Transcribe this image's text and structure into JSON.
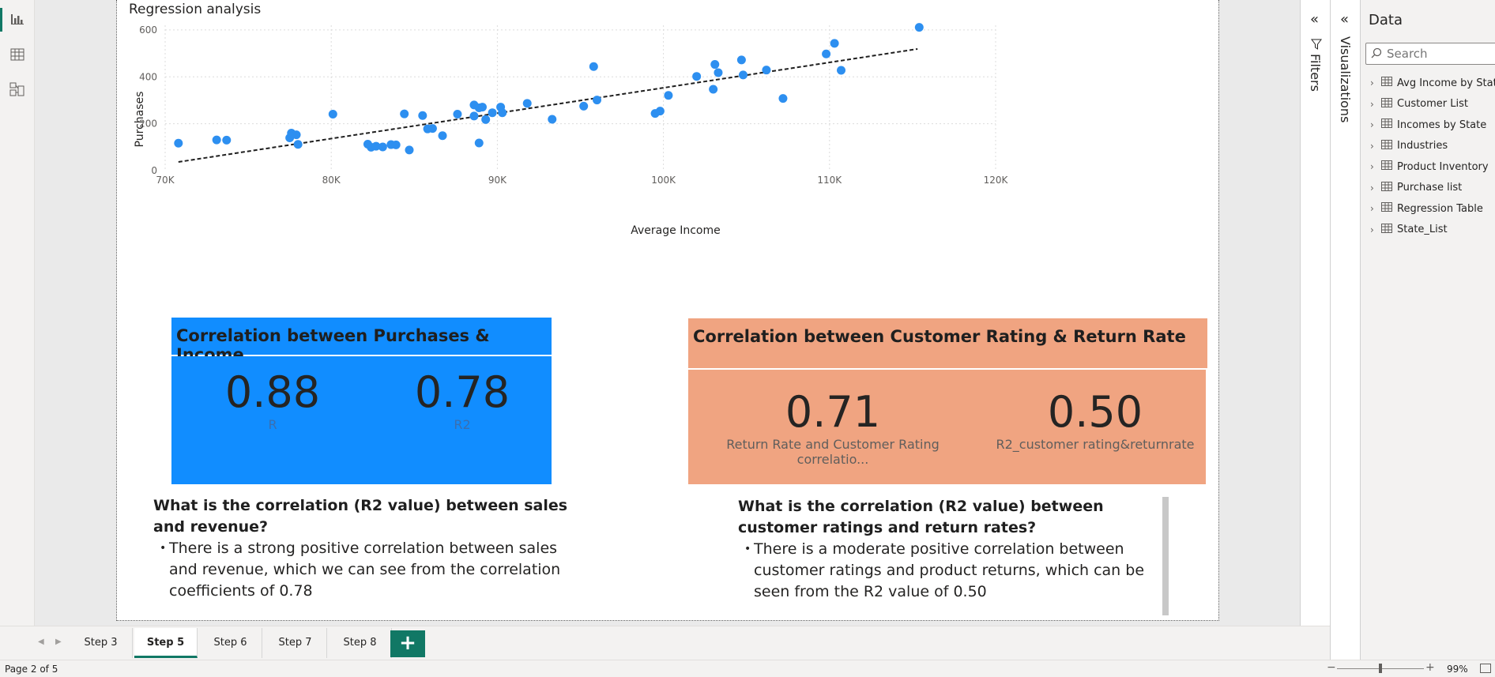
{
  "left_rail": {
    "icons": [
      "report-view-icon",
      "table-view-icon",
      "model-view-icon"
    ]
  },
  "scatter": {
    "title": "Regression analysis",
    "ylabel": "Purchases",
    "xlabel": "Average Income",
    "point_color": "#2d8ff0"
  },
  "chart_data": {
    "type": "scatter",
    "title": "Regression analysis",
    "xlabel": "Average Income",
    "ylabel": "Purchases",
    "xlim": [
      70000,
      120000
    ],
    "ylim": [
      0,
      620
    ],
    "x_ticks": [
      70000,
      80000,
      90000,
      100000,
      110000,
      120000
    ],
    "x_tick_labels": [
      "70K",
      "80K",
      "90K",
      "100K",
      "110K",
      "120K"
    ],
    "y_ticks": [
      0,
      200,
      400,
      600
    ],
    "y_tick_labels": [
      "0",
      "200",
      "400",
      "600"
    ],
    "grid": true,
    "trend_line": {
      "x": [
        70800,
        115300
      ],
      "y": [
        37,
        519
      ],
      "style": "dashed"
    },
    "points": [
      {
        "x": 70800,
        "y": 117
      },
      {
        "x": 73100,
        "y": 131
      },
      {
        "x": 73700,
        "y": 130
      },
      {
        "x": 77500,
        "y": 140
      },
      {
        "x": 77600,
        "y": 160
      },
      {
        "x": 77900,
        "y": 153
      },
      {
        "x": 78000,
        "y": 112
      },
      {
        "x": 80100,
        "y": 241
      },
      {
        "x": 82200,
        "y": 113
      },
      {
        "x": 82400,
        "y": 100
      },
      {
        "x": 82700,
        "y": 104
      },
      {
        "x": 83100,
        "y": 101
      },
      {
        "x": 83600,
        "y": 111
      },
      {
        "x": 83900,
        "y": 110
      },
      {
        "x": 84400,
        "y": 242
      },
      {
        "x": 84700,
        "y": 88
      },
      {
        "x": 85500,
        "y": 235
      },
      {
        "x": 85800,
        "y": 178
      },
      {
        "x": 86100,
        "y": 180
      },
      {
        "x": 86700,
        "y": 149
      },
      {
        "x": 87600,
        "y": 241
      },
      {
        "x": 88600,
        "y": 280
      },
      {
        "x": 88600,
        "y": 233
      },
      {
        "x": 88900,
        "y": 268
      },
      {
        "x": 88900,
        "y": 118
      },
      {
        "x": 89100,
        "y": 271
      },
      {
        "x": 89300,
        "y": 218
      },
      {
        "x": 89700,
        "y": 247
      },
      {
        "x": 90200,
        "y": 271
      },
      {
        "x": 90300,
        "y": 247
      },
      {
        "x": 91800,
        "y": 287
      },
      {
        "x": 93300,
        "y": 219
      },
      {
        "x": 95200,
        "y": 275
      },
      {
        "x": 95800,
        "y": 444
      },
      {
        "x": 96000,
        "y": 301
      },
      {
        "x": 99500,
        "y": 244
      },
      {
        "x": 99800,
        "y": 254
      },
      {
        "x": 100300,
        "y": 321
      },
      {
        "x": 102000,
        "y": 402
      },
      {
        "x": 103000,
        "y": 347
      },
      {
        "x": 103100,
        "y": 453
      },
      {
        "x": 103300,
        "y": 418
      },
      {
        "x": 104700,
        "y": 472
      },
      {
        "x": 104800,
        "y": 408
      },
      {
        "x": 106200,
        "y": 429
      },
      {
        "x": 107200,
        "y": 308
      },
      {
        "x": 109800,
        "y": 498
      },
      {
        "x": 110300,
        "y": 543
      },
      {
        "x": 110700,
        "y": 428
      },
      {
        "x": 115400,
        "y": 611
      }
    ]
  },
  "card_left": {
    "title": "Correlation between Purchases & Income",
    "kpis": [
      {
        "value": "0.88",
        "label": "R"
      },
      {
        "value": "0.78",
        "label": "R2"
      }
    ],
    "color": "#118dff"
  },
  "card_right": {
    "title": "Correlation between Customer Rating & Return Rate",
    "kpis": [
      {
        "value": "0.71",
        "label": "Return Rate and Customer Rating correlatio..."
      },
      {
        "value": "0.50",
        "label": "R2_customer rating&returnrate"
      }
    ],
    "color": "#f0a481"
  },
  "qa_left": {
    "question": "What is the correlation (R2 value) between sales and revenue?",
    "answer": "There is a strong positive correlation between sales and revenue, which we can see from the correlation coefficients of 0.78"
  },
  "qa_right": {
    "question": "What is the correlation (R2 value) between customer ratings and return rates?",
    "answer": "There is a moderate positive correlation between customer ratings and product returns, which can be seen from the R2 value of 0.50"
  },
  "panes": {
    "filters_label": "Filters",
    "visualizations_label": "Visualizations"
  },
  "data_pane": {
    "title": "Data",
    "search_placeholder": "Search",
    "tables": [
      "Avg Income by State",
      "Customer List",
      "Incomes by State",
      "Industries",
      "Product Inventory",
      "Purchase list",
      "Regression Table",
      "State_List"
    ]
  },
  "tabs": {
    "items": [
      "Step 3",
      "Step 5",
      "Step 6",
      "Step 7",
      "Step 8"
    ],
    "active": "Step 5",
    "add_label": "+"
  },
  "status": {
    "page_info": "Page 2 of 5",
    "zoom": "99%",
    "zoom_level": 0.5
  }
}
